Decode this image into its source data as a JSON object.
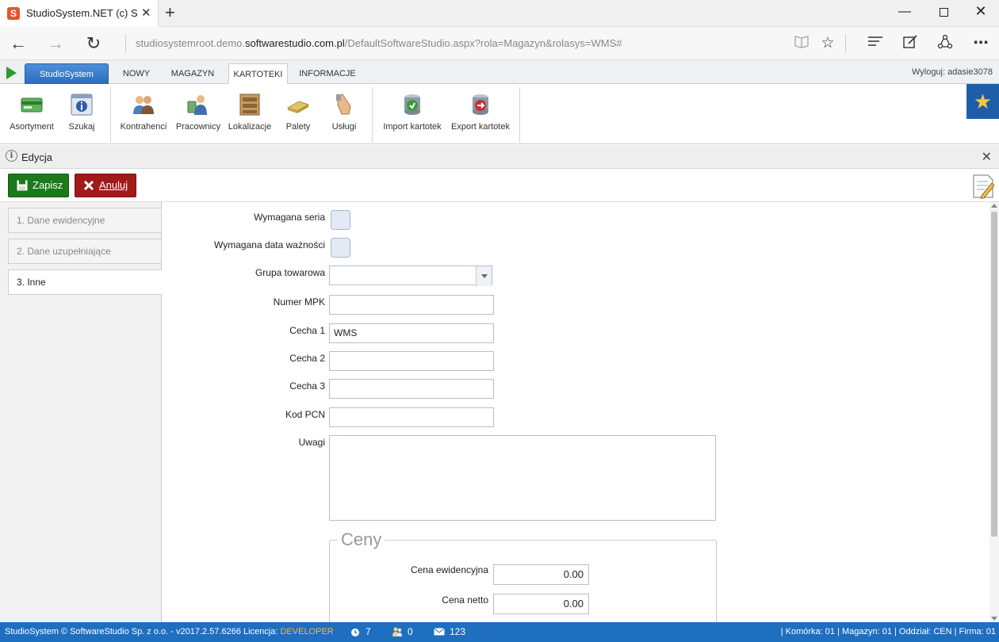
{
  "browser": {
    "tab_title": "StudioSystem.NET (c) Sc",
    "tab_close": "✕",
    "new_tab": "+",
    "url_prefix": "studiosystemroot.demo.",
    "url_domain": "softwarestudio.com.pl",
    "url_path": "/DefaultSoftwareStudio.aspx?rola=Magazyn&rolasys=WMS#",
    "icons": [
      "back-icon",
      "forward-icon",
      "refresh-icon",
      "reading-view-icon",
      "favorite-star-icon",
      "hub-icon",
      "web-note-icon",
      "share-icon",
      "more-icon"
    ]
  },
  "menu": {
    "brand": "StudioSystem",
    "tabs": [
      {
        "label": "NOWY"
      },
      {
        "label": "MAGAZYN"
      },
      {
        "label": "KARTOTEKI",
        "active": true
      },
      {
        "label": "INFORMACJE"
      }
    ],
    "logout": "Wyloguj: adasie3078"
  },
  "ribbon": {
    "items": [
      {
        "label": "Asortyment",
        "icon": "assortment-icon"
      },
      {
        "label": "Szukaj",
        "icon": "search-info-icon"
      },
      {
        "label": "Kontrahenci",
        "icon": "contractors-icon"
      },
      {
        "label": "Pracownicy",
        "icon": "employees-icon"
      },
      {
        "label": "Lokalizacje",
        "icon": "shelf-icon"
      },
      {
        "label": "Palety",
        "icon": "pallet-icon"
      },
      {
        "label": "Usługi",
        "icon": "services-hand-icon"
      },
      {
        "label": "Import kartotek",
        "icon": "import-database-icon"
      },
      {
        "label": "Export kartotek",
        "icon": "export-database-icon"
      }
    ]
  },
  "panel": {
    "title": "Edycja",
    "save_label": "Zapisz",
    "cancel_label": "Anuluj"
  },
  "sidenav": {
    "tabs": [
      {
        "label": "1. Dane ewidencyjne"
      },
      {
        "label": "2. Dane uzupełniające"
      },
      {
        "label": "3. Inne",
        "active": true
      }
    ]
  },
  "form": {
    "wymagana_seria": {
      "label": "Wymagana seria",
      "checked": false
    },
    "wymagana_data": {
      "label": "Wymagana data ważności",
      "checked": false
    },
    "grupa_towarowa": {
      "label": "Grupa towarowa",
      "value": ""
    },
    "numer_mpk": {
      "label": "Numer MPK",
      "value": ""
    },
    "cecha1": {
      "label": "Cecha 1",
      "value": "WMS"
    },
    "cecha2": {
      "label": "Cecha 2",
      "value": ""
    },
    "cecha3": {
      "label": "Cecha 3",
      "value": ""
    },
    "kod_pcn": {
      "label": "Kod PCN",
      "value": ""
    },
    "uwagi": {
      "label": "Uwagi",
      "value": ""
    },
    "ceny": {
      "legend": "Ceny",
      "cena_ewidencyjna": {
        "label": "Cena ewidencyjna",
        "value": "0.00"
      },
      "cena_netto": {
        "label": "Cena netto",
        "value": "0.00"
      }
    }
  },
  "status": {
    "copyright": "StudioSystem © SoftwareStudio Sp. z o.o. - v2017.2.57.6266",
    "licencja_label": "Licencja:",
    "licencja_value": "DEVELOPER",
    "alarms": "7",
    "users": "0",
    "messages": "123",
    "right": "| Komórka: 01 | Magazyn: 01 | Oddział: CEN | Firma: 01"
  },
  "colors": {
    "brand_blue": "#1e6fc0",
    "save_green": "#1a7a1a",
    "cancel_red": "#a11a1a",
    "license_orange": "#f5b942"
  }
}
